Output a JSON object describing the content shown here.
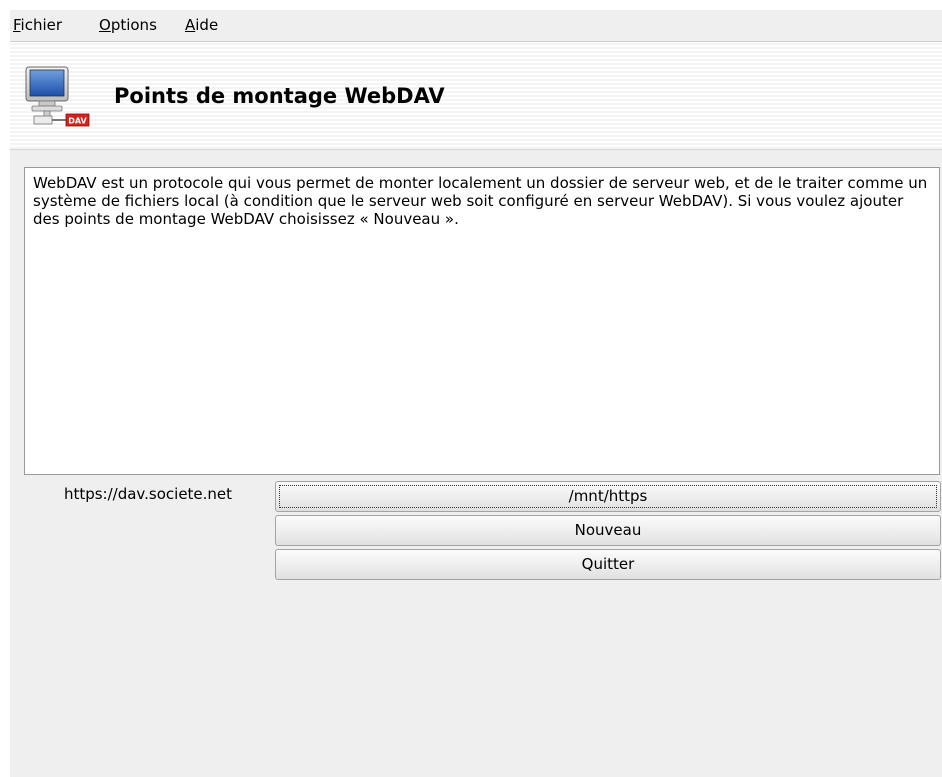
{
  "menubar": {
    "items": [
      {
        "mnemonic": "F",
        "rest": "ichier"
      },
      {
        "mnemonic": "O",
        "rest": "ptions"
      },
      {
        "mnemonic": "A",
        "rest": "ide"
      }
    ]
  },
  "header": {
    "icon": "webdav-network-icon",
    "icon_badge": "DAV",
    "title": "Points de montage WebDAV"
  },
  "description": "WebDAV est un protocole qui vous permet de monter localement un dossier de serveur web, et de le traiter comme un système de fichiers local (à condition que le serveur web soit configuré en serveur WebDAV). Si vous voulez ajouter des points de montage WebDAV choisissez « Nouveau ».",
  "mounts": [
    {
      "server": "https://dav.societe.net",
      "mount_point": "/mnt/https"
    }
  ],
  "buttons": {
    "new": "Nouveau",
    "quit": "Quitter"
  },
  "colors": {
    "window_bg": "#efefef",
    "badge_red": "#d8201c"
  }
}
